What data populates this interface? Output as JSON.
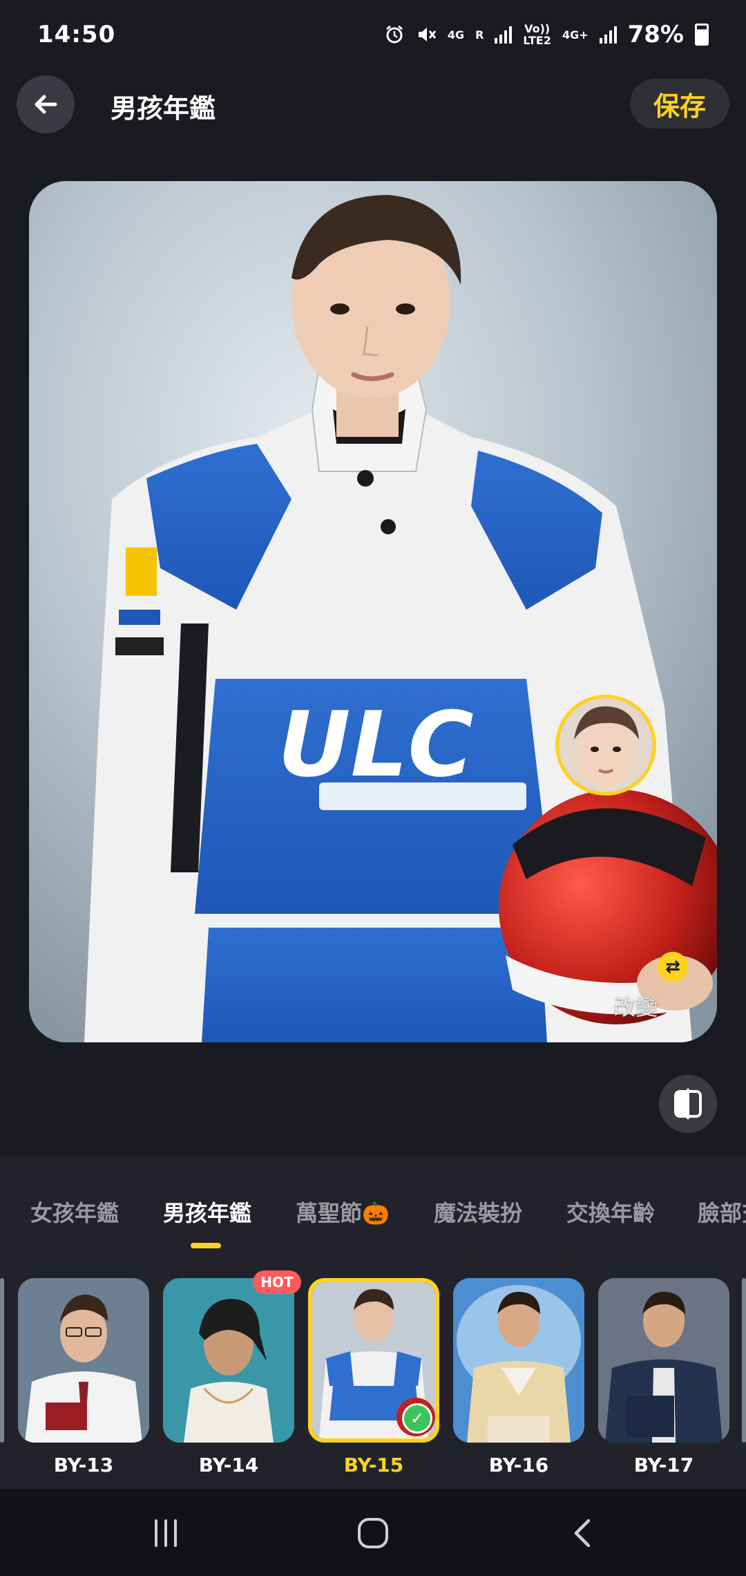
{
  "status_bar": {
    "time": "14:50",
    "network_1": "4G",
    "network_2": "R",
    "volte_top": "Vo))",
    "volte_bottom": "LTE2",
    "network_3": "4G+",
    "battery": "78%",
    "icons": [
      "alarm-icon",
      "mute-icon",
      "signal-icon",
      "battery-icon"
    ]
  },
  "header": {
    "title": "男孩年鑑",
    "save_label": "保存",
    "back_icon": "back-arrow-icon"
  },
  "main_image": {
    "swap_label": "改變",
    "swap_icon": "swap-arrows-icon"
  },
  "compare_icon": "compare-split-icon",
  "tabs": [
    {
      "label": "女孩年鑑",
      "active": false
    },
    {
      "label": "男孩年鑑",
      "active": true
    },
    {
      "label": "萬聖節🎃",
      "active": false
    },
    {
      "label": "魔法裝扮",
      "active": false
    },
    {
      "label": "交換年齡",
      "active": false
    },
    {
      "label": "臉部交",
      "active": false
    }
  ],
  "styles": [
    {
      "label": "BY-13",
      "selected": false,
      "hot": false
    },
    {
      "label": "BY-14",
      "selected": false,
      "hot": true
    },
    {
      "label": "BY-15",
      "selected": true,
      "hot": false
    },
    {
      "label": "BY-16",
      "selected": false,
      "hot": false
    },
    {
      "label": "BY-17",
      "selected": false,
      "hot": false
    }
  ],
  "hot_badge": "HOT",
  "nav": {
    "recents_icon": "recents-icon",
    "home_icon": "home-icon",
    "back_icon": "nav-back-icon"
  },
  "colors": {
    "accent": "#ffd21e",
    "background": "#1a1b20",
    "panel": "#22232a",
    "hot": "#ff5a5a",
    "check": "#3cc45a"
  }
}
